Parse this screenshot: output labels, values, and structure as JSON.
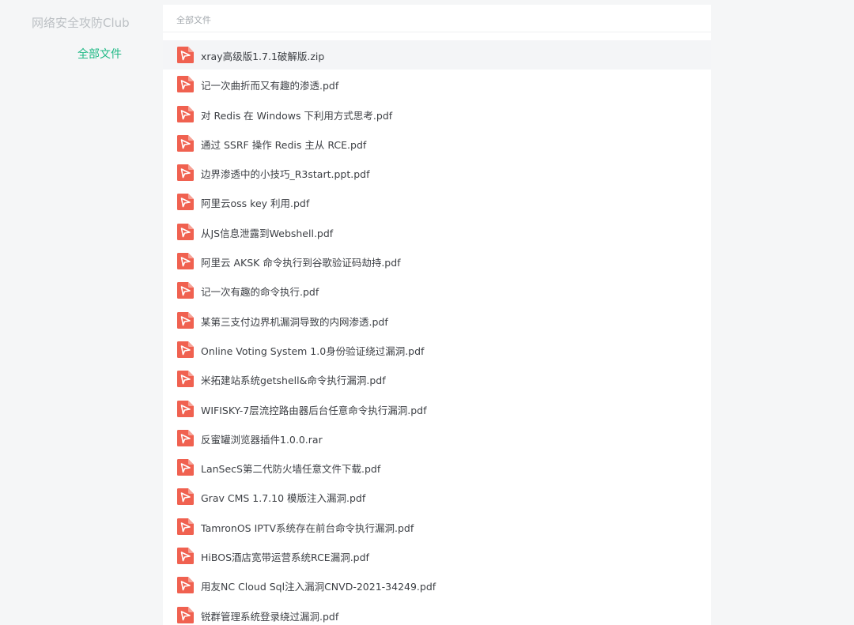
{
  "sidebar": {
    "club_name": "网络安全攻防Club",
    "nav_all_label": "全部文件"
  },
  "breadcrumb": "全部文件",
  "accent_color": "#1fb985",
  "file_icon": "pdf-file-icon",
  "file_icon_color": "#f06150",
  "files": [
    "xray高级版1.7.1破解版.zip",
    "记一次曲折而又有趣的渗透.pdf",
    "对 Redis 在 Windows 下利用方式思考.pdf",
    "通过 SSRF 操作 Redis 主从 RCE.pdf",
    "边界渗透中的小技巧_R3start.ppt.pdf",
    "阿里云oss key 利用.pdf",
    "从JS信息泄露到Webshell.pdf",
    "阿里云 AKSK 命令执行到谷歌验证码劫持.pdf",
    "记一次有趣的命令执行.pdf",
    "某第三支付边界机漏洞导致的内网渗透.pdf",
    "Online Voting System 1.0身份验证绕过漏洞.pdf",
    "米拓建站系统getshell&命令执行漏洞.pdf",
    "WIFISKY-7层流控路由器后台任意命令执行漏洞.pdf",
    "反蜜罐浏览器插件1.0.0.rar",
    "LanSecS第二代防火墙任意文件下载.pdf",
    "Grav CMS 1.7.10 模版注入漏洞.pdf",
    "TamronOS IPTV系统存在前台命令执行漏洞.pdf",
    "HiBOS酒店宽带运营系统RCE漏洞.pdf",
    "用友NC Cloud Sql注入漏洞CNVD-2021-34249.pdf",
    "锐群管理系统登录绕过漏洞.pdf"
  ]
}
